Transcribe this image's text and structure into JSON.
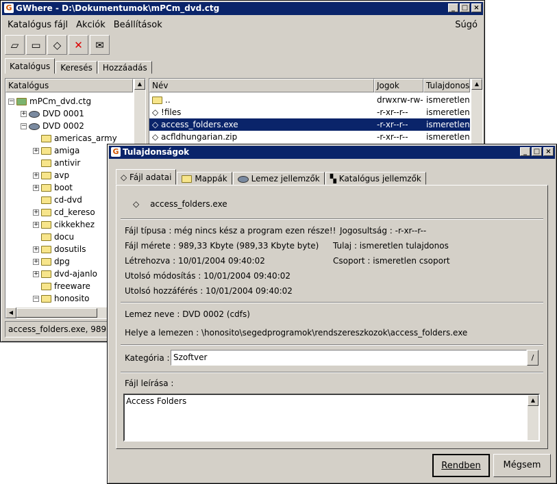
{
  "main_window": {
    "title": "GWhere - D:\\Dokumentumok\\mPCm_dvd.ctg",
    "menu": [
      "Katalógus fájl",
      "Akciók",
      "Beállítások"
    ],
    "help_menu": "Súgó",
    "tabs": [
      "Katalógus",
      "Keresés",
      "Hozzáadás"
    ],
    "tree_header": "Katalógus",
    "tree": [
      {
        "label": "mPCm_dvd.ctg",
        "level": 0,
        "kind": "catalog",
        "expander": "−"
      },
      {
        "label": "DVD 0001",
        "level": 1,
        "kind": "cd",
        "expander": "+"
      },
      {
        "label": "DVD 0002",
        "level": 1,
        "kind": "cd",
        "expander": "−"
      },
      {
        "label": "americas_army",
        "level": 2,
        "kind": "folder",
        "expander": ""
      },
      {
        "label": "amiga",
        "level": 2,
        "kind": "folder",
        "expander": "+"
      },
      {
        "label": "antivir",
        "level": 2,
        "kind": "folder",
        "expander": ""
      },
      {
        "label": "avp",
        "level": 2,
        "kind": "folder",
        "expander": "+"
      },
      {
        "label": "boot",
        "level": 2,
        "kind": "folder",
        "expander": "+"
      },
      {
        "label": "cd-dvd",
        "level": 2,
        "kind": "folder",
        "expander": ""
      },
      {
        "label": "cd_kereso",
        "level": 2,
        "kind": "folder",
        "expander": "+"
      },
      {
        "label": "cikkekhez",
        "level": 2,
        "kind": "folder",
        "expander": "+"
      },
      {
        "label": "docu",
        "level": 2,
        "kind": "folder",
        "expander": ""
      },
      {
        "label": "dosutils",
        "level": 2,
        "kind": "folder",
        "expander": "+"
      },
      {
        "label": "dpg",
        "level": 2,
        "kind": "folder",
        "expander": "+"
      },
      {
        "label": "dvd-ajanlo",
        "level": 2,
        "kind": "folder",
        "expander": "+"
      },
      {
        "label": "freeware",
        "level": 2,
        "kind": "folder",
        "expander": ""
      },
      {
        "label": "honosito",
        "level": 2,
        "kind": "folder-open",
        "expander": "−"
      }
    ],
    "columns": [
      "Név",
      "Jogok",
      "Tulajdonos"
    ],
    "files": [
      {
        "name": "..",
        "perm": "drwxrw-rw-",
        "owner": "ismeretlen",
        "icon": "folder-up-icon"
      },
      {
        "name": "!files",
        "perm": "-r-xr--r--",
        "owner": "ismeretlen",
        "icon": "file-icon"
      },
      {
        "name": "access_folders.exe",
        "perm": "-r-xr--r--",
        "owner": "ismeretlen",
        "icon": "file-icon",
        "selected": true
      },
      {
        "name": "acfldhungarian.zip",
        "perm": "-r-xr--r--",
        "owner": "ismeretlen",
        "icon": "file-icon"
      }
    ],
    "status": "access_folders.exe, 989"
  },
  "dialog": {
    "title": "Tulajdonságok",
    "tabs": [
      "Fájl adatai",
      "Mappák",
      "Lemez jellemzők",
      "Katalógus jellemzők"
    ],
    "file_name": "access_folders.exe",
    "fields": {
      "type": "Fájl típusa : még nincs kész a program ezen része!!",
      "rights": "Jogosultság : -r-xr--r--",
      "size": "Fájl mérete : 989,33  Kbyte (989,33  Kbyte byte)",
      "owner": "Tulaj : ismeretlen tulajdonos",
      "created": "Létrehozva : 10/01/2004 09:40:02",
      "group": "Csoport : ismeretlen csoport",
      "modified": "Utolsó módosítás : 10/01/2004 09:40:02",
      "accessed": "Utolsó hozzáférés : 10/01/2004 09:40:02",
      "disk_name": "Lemez neve : DVD 0002 (cdfs)",
      "location": "Helye a lemezen : \\honosito\\segedprogramok\\rendszereszkozok\\access_folders.exe"
    },
    "category_label": "Kategória :",
    "category_value": "Szoftver",
    "description_label": "Fájl leírása :",
    "description_value": "Access Folders",
    "ok_label": "Rendben",
    "cancel_label": "Mégsem"
  }
}
